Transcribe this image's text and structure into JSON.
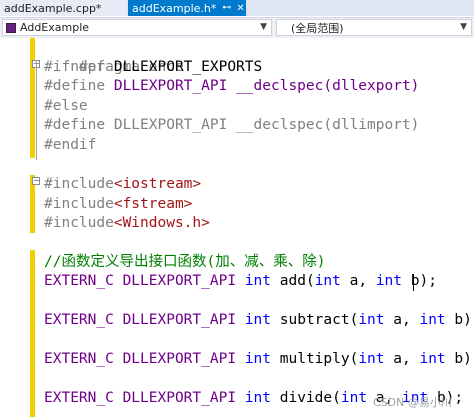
{
  "tabs": [
    {
      "label": "addExample.cpp*",
      "active": false
    },
    {
      "label": "addExample.h*",
      "active": true
    }
  ],
  "nav": {
    "project": "AddExample",
    "scope": "(全局范围)"
  },
  "code": {
    "line1": "#pragma once",
    "ifndef_kw": "#ifndef",
    "ifndef_name": " DLLEXPORT_EXPORTS",
    "define_kw": "#define",
    "define1_name": " DLLEXPORT_API",
    "declspec": "__declspec",
    "export_paren": "(dllexport)",
    "else_kw": "#else",
    "define2_kw": "#define",
    "define2_name": " DLLEXPORT_API",
    "declspec2": "__declspec",
    "import_paren": "(dllimport)",
    "endif_kw": "#endif",
    "include_kw": "#include",
    "inc1": "<iostream>",
    "inc2": "<fstream>",
    "inc3": "<Windows.h>",
    "comment": "//函数定义导出接口函数(加、减、乘、除)",
    "extern_c": "EXTERN_C",
    "api": "DLLEXPORT_API",
    "int_kw": "int",
    "fn_add": "add",
    "fn_subtract": "subtract",
    "fn_multiply": "multiply",
    "fn_divide": "divide",
    "param_a": " a,",
    "param_b": " b);",
    "open": "(",
    "space": " "
  },
  "watermark": "CSDN @易小川",
  "colors": {
    "keyword": "#0000ff",
    "preprocessor": "#808080",
    "macro": "#6f008a",
    "string": "#a31515",
    "comment": "#008000",
    "changed_margin": "#f0d000",
    "saved_margin": "#57a64a",
    "tab_active": "#007acc"
  }
}
